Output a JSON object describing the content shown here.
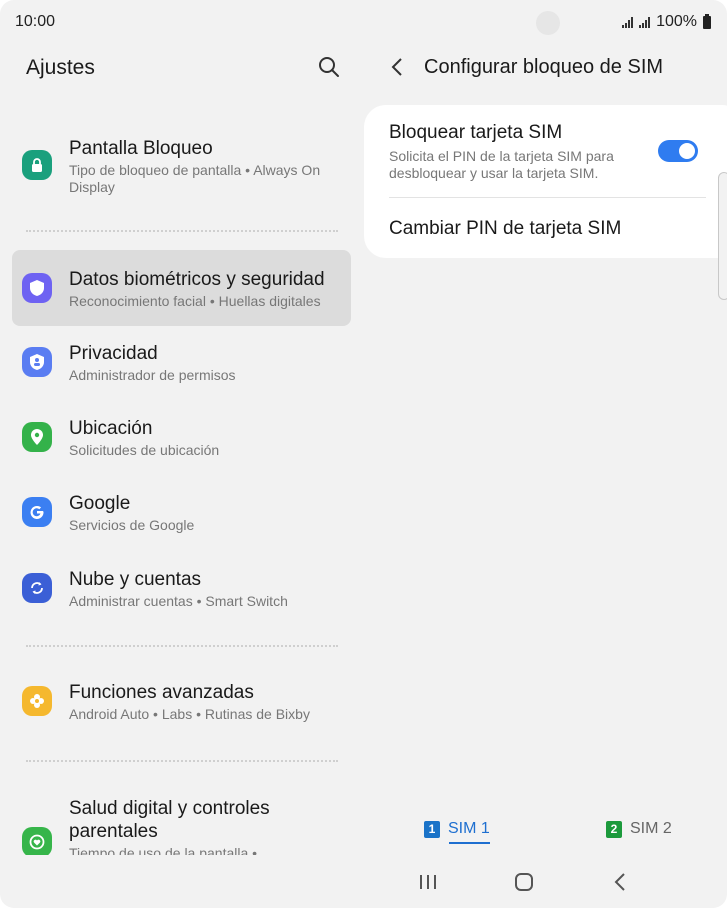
{
  "status": {
    "time": "10:00",
    "battery": "100%"
  },
  "left": {
    "title": "Ajustes",
    "items": [
      {
        "title": "Pantalla Bloqueo",
        "sub": "Tipo de bloqueo de pantalla  •  Always On Display",
        "icon": "lock-icon",
        "color": "#1aa07d"
      },
      {
        "title": "Datos biométricos y seguridad",
        "sub": "Reconocimiento facial  •  Huellas digitales",
        "icon": "shield-icon",
        "color": "#6e62f2"
      },
      {
        "title": "Privacidad",
        "sub": "Administrador de permisos",
        "icon": "privacy-icon",
        "color": "#5a7df2"
      },
      {
        "title": "Ubicación",
        "sub": "Solicitudes de ubicación",
        "icon": "location-icon",
        "color": "#34b24a"
      },
      {
        "title": "Google",
        "sub": "Servicios de Google",
        "icon": "google-icon",
        "color": "#3b7ff2"
      },
      {
        "title": "Nube y cuentas",
        "sub": "Administrar cuentas  •  Smart Switch",
        "icon": "sync-icon",
        "color": "#3b5fd6"
      },
      {
        "title": "Funciones avanzadas",
        "sub": "Android Auto  •  Labs  •  Rutinas de Bixby",
        "icon": "puzzle-icon",
        "color": "#f5b82e"
      },
      {
        "title": "Salud digital y controles parentales",
        "sub": "Tiempo de uso de la pantalla  •",
        "icon": "wellbeing-icon",
        "color": "#36b54a"
      }
    ]
  },
  "right": {
    "title": "Configurar bloqueo de SIM",
    "lock_title": "Bloquear tarjeta SIM",
    "lock_sub": "Solicita el PIN de la tarjeta SIM para desbloquear y usar la tarjeta SIM.",
    "lock_enabled": true,
    "change_pin": "Cambiar PIN de tarjeta SIM"
  },
  "sim_tabs": [
    {
      "badge": "1",
      "label": "SIM 1",
      "selected": true,
      "color": "#1a73c8"
    },
    {
      "badge": "2",
      "label": "SIM 2",
      "selected": false,
      "color": "#1c9a3c"
    }
  ],
  "accent": "#2f7cf0"
}
